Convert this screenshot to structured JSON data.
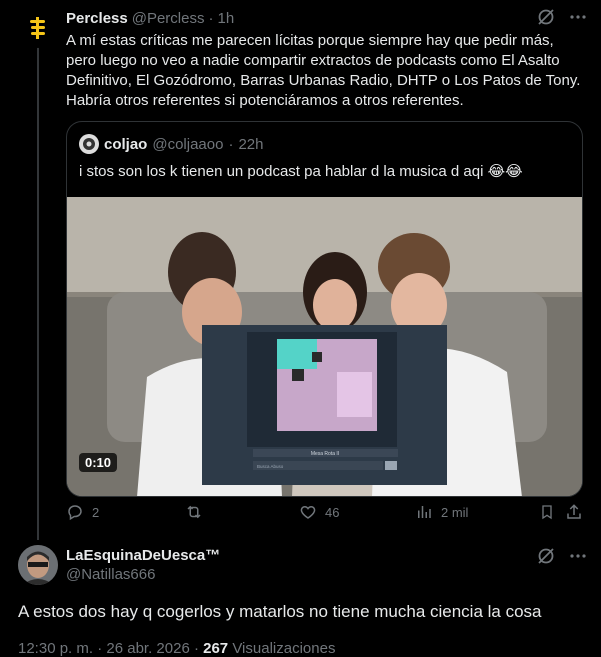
{
  "post": {
    "author_name": "Percless",
    "handle": "@Percless",
    "separator": "·",
    "time": "1h",
    "body": "A mí estas críticas me parecen lícitas porque siempre hay que pedir más,\npero luego no veo a nadie compartir extractos de podcasts como El Asalto\nDefinitivo, El Gozódromo, Barras Urbanas Radio, DHTP o Los Patos de Tony.\nHabría otros referentes si potenciáramos a otros referentes.",
    "stats": {
      "replies": "2",
      "reposts": "",
      "likes": "46",
      "views": "2 mil"
    }
  },
  "quote": {
    "author_name": "coljao",
    "handle": "@coljaaoo",
    "separator": "·",
    "time": "22h",
    "body": "i stos son los k tienen un podcast pa hablar d la musica d aqi 😂😂",
    "video_duration": "0:10",
    "screen_title": "Mesa Rota II",
    "screen_input": "Busca Abuso"
  },
  "reply": {
    "author_name": "LaEsquinaDeUesca™",
    "handle": "@Natillas666",
    "body": "A estos dos hay q cogerlos y matarlos no tiene mucha ciencia la cosa",
    "meta_time": "12:30 p. m. · 26 abr. 2026 · ",
    "meta_views_count": "267",
    "meta_views_label": " Visualizaciones"
  },
  "colors": {
    "background": "#000000",
    "text": "#e7e9ea",
    "muted": "#71767b",
    "border": "#2f3336",
    "brand": "#f5c518"
  },
  "icons": [
    "percless-logo-icon",
    "grok-icon",
    "more-icon",
    "reply-icon",
    "repost-icon",
    "like-icon",
    "views-icon",
    "bookmark-icon",
    "share-icon"
  ]
}
